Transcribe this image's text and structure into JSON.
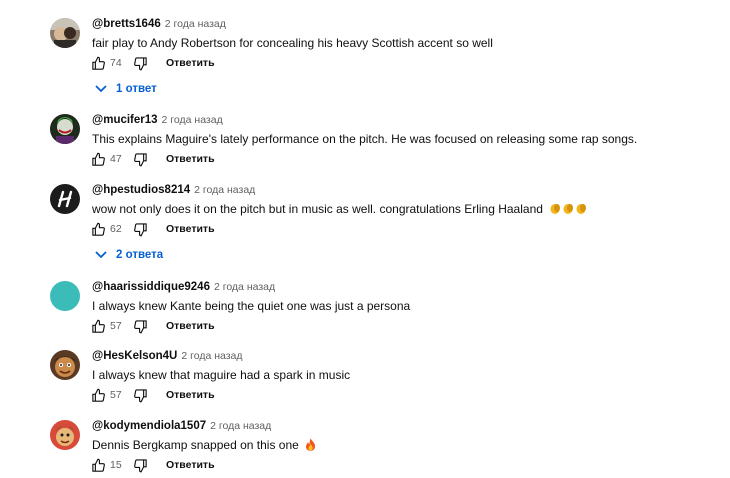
{
  "comments": [
    {
      "author": "@bretts1646",
      "time": "2 года назад",
      "text": "fair play to Andy Robertson for concealing his heavy Scottish accent so well",
      "likes": "74",
      "reply_label": "Ответить",
      "replies_label": "1 ответ",
      "avatar_icon": "photo-avatar"
    },
    {
      "author": "@mucifer13",
      "time": "2 года назад",
      "text": "This explains Maguire's lately performance on the pitch. He was focused on releasing some rap songs.",
      "likes": "47",
      "reply_label": "Ответить",
      "avatar_icon": "joker-avatar"
    },
    {
      "author": "@hpestudios8214",
      "time": "2 года назад",
      "text": "wow not only does it on the pitch but in music as well. congratulations Erling Haaland",
      "emoji": "clapping-hands x3",
      "likes": "62",
      "reply_label": "Ответить",
      "replies_label": "2 ответа",
      "avatar_icon": "h-logo-avatar"
    },
    {
      "author": "@haarissiddique9246",
      "time": "2 года назад",
      "text": "I always knew Kante being the quiet one was just a persona",
      "likes": "57",
      "reply_label": "Ответить",
      "avatar_color": "#3bbcb8"
    },
    {
      "author": "@HesKelson4U",
      "time": "2 года назад",
      "text": "I always knew that maguire had a spark in music",
      "likes": "57",
      "reply_label": "Ответить",
      "avatar_icon": "cartoon-face-avatar"
    },
    {
      "author": "@kodymendiola1507",
      "time": "2 года назад",
      "text": "Dennis Bergkamp snapped on this one",
      "emoji": "fire",
      "likes": "15",
      "reply_label": "Ответить",
      "avatar_icon": "cartoon-character-avatar"
    }
  ],
  "colors": {
    "link_blue": "#065fd4",
    "muted": "#606060",
    "text": "#0f0f0f"
  }
}
